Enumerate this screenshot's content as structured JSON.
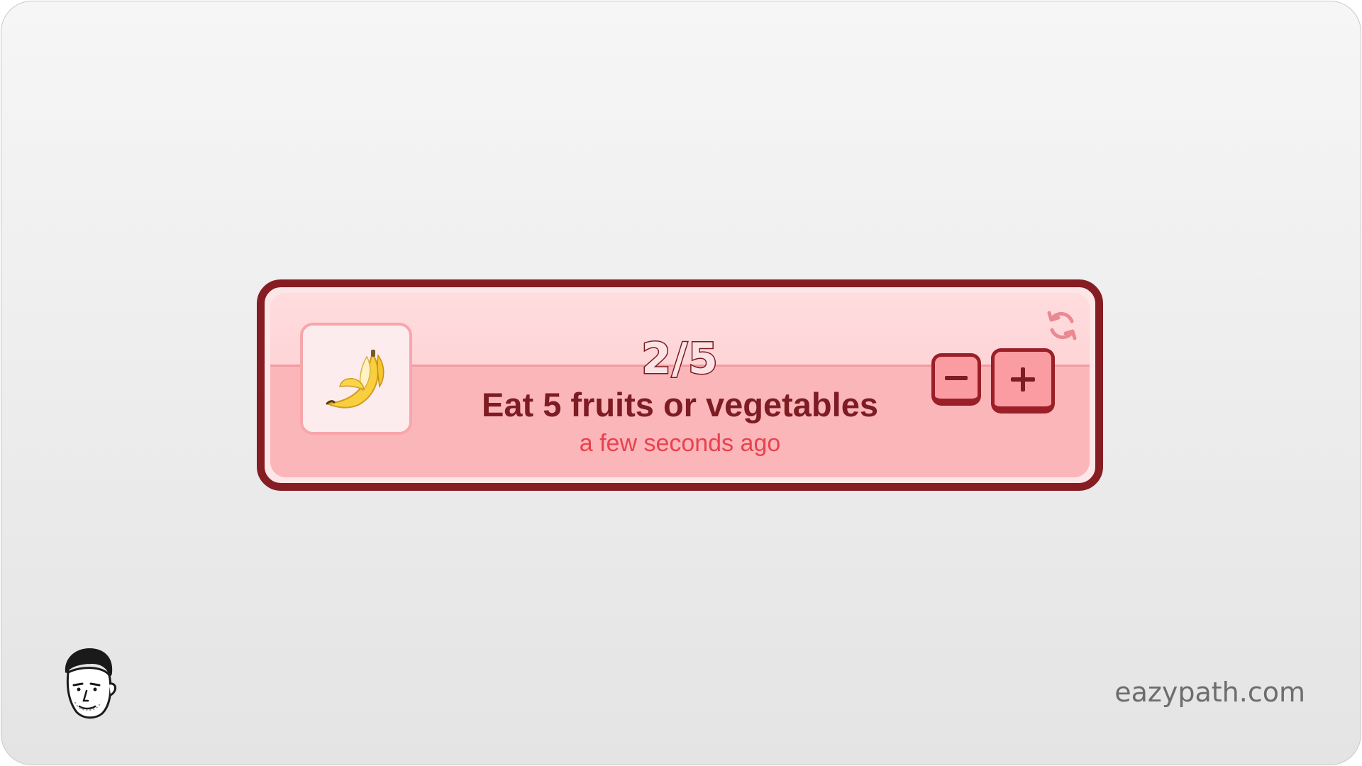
{
  "habit": {
    "count_text": "2/5",
    "completed": 2,
    "target": 5,
    "progress_fraction": 0.4,
    "title": "Eat 5 fruits or vegetables",
    "last_updated": "a few seconds ago",
    "emoji": "🍌",
    "icon_name": "banana-icon",
    "theme": {
      "border": "#851d23",
      "background": "#fdc9cc",
      "accent": "#e8424e"
    }
  },
  "controls": {
    "decrement_icon": "minus-icon",
    "increment_icon": "plus-icon",
    "reset_icon": "refresh-icon"
  },
  "branding": {
    "site": "eazypath.com",
    "avatar_icon": "avatar-icon"
  }
}
